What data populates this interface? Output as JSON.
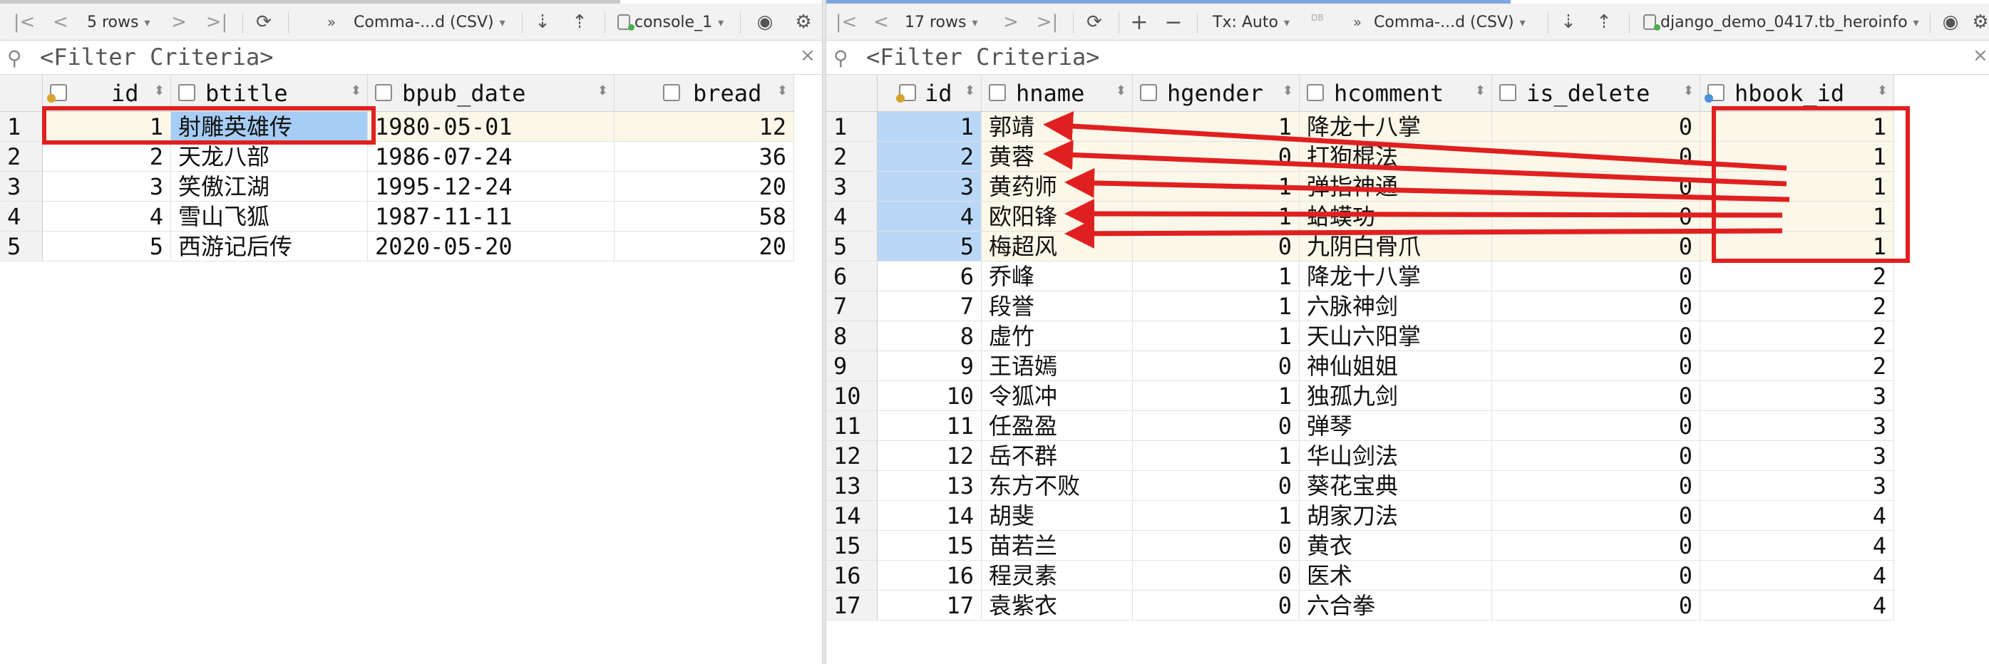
{
  "left": {
    "toolbar": {
      "first_icon": "|<",
      "prev_icon": "<",
      "rows": "5 rows",
      "next_icon": ">",
      "last_icon": ">|",
      "refresh_icon": "refresh-icon",
      "more_icon": "»",
      "format": "Comma-...d (CSV)",
      "download_icon": "⇣",
      "upload_icon": "⇡",
      "console": "console_1",
      "eye_icon": "eye-icon",
      "gear_icon": "gear-icon"
    },
    "filter": {
      "icon": "search-icon",
      "placeholder": "<Filter Criteria>",
      "clear": "×"
    },
    "columns": [
      "id",
      "btitle",
      "bpub_date",
      "bread"
    ],
    "rows": [
      {
        "n": "1",
        "id": "1",
        "btitle": "射雕英雄传",
        "bpub_date": "1980-05-01",
        "bread": "12"
      },
      {
        "n": "2",
        "id": "2",
        "btitle": "天龙八部",
        "bpub_date": "1986-07-24",
        "bread": "36"
      },
      {
        "n": "3",
        "id": "3",
        "btitle": "笑傲江湖",
        "bpub_date": "1995-12-24",
        "bread": "20"
      },
      {
        "n": "4",
        "id": "4",
        "btitle": "雪山飞狐",
        "bpub_date": "1987-11-11",
        "bread": "58"
      },
      {
        "n": "5",
        "id": "5",
        "btitle": "西游记后传",
        "bpub_date": "2020-05-20",
        "bread": "20"
      }
    ]
  },
  "right": {
    "toolbar": {
      "first_icon": "|<",
      "prev_icon": "<",
      "rows": "17 rows",
      "next_icon": ">",
      "last_icon": ">|",
      "refresh_icon": "refresh-icon",
      "add_icon": "+",
      "remove_icon": "−",
      "tx": "Tx: Auto",
      "db_label": "DB",
      "more_icon": "»",
      "format": "Comma-...d (CSV)",
      "download_icon": "⇣",
      "upload_icon": "⇡",
      "table": "django_demo_0417.tb_heroinfo",
      "eye_icon": "eye-icon",
      "gear_icon": "gear-icon"
    },
    "filter": {
      "icon": "search-icon",
      "placeholder": "<Filter Criteria>",
      "clear": "×"
    },
    "columns": [
      "id",
      "hname",
      "hgender",
      "hcomment",
      "is_delete",
      "hbook_id"
    ],
    "rows": [
      {
        "n": "1",
        "id": "1",
        "hname": "郭靖",
        "hgender": "1",
        "hcomment": "降龙十八掌",
        "is_delete": "0",
        "hbook_id": "1"
      },
      {
        "n": "2",
        "id": "2",
        "hname": "黄蓉",
        "hgender": "0",
        "hcomment": "打狗棍法",
        "is_delete": "0",
        "hbook_id": "1"
      },
      {
        "n": "3",
        "id": "3",
        "hname": "黄药师",
        "hgender": "1",
        "hcomment": "弹指神通",
        "is_delete": "0",
        "hbook_id": "1"
      },
      {
        "n": "4",
        "id": "4",
        "hname": "欧阳锋",
        "hgender": "1",
        "hcomment": "蛤蟆功",
        "is_delete": "0",
        "hbook_id": "1"
      },
      {
        "n": "5",
        "id": "5",
        "hname": "梅超风",
        "hgender": "0",
        "hcomment": "九阴白骨爪",
        "is_delete": "0",
        "hbook_id": "1"
      },
      {
        "n": "6",
        "id": "6",
        "hname": "乔峰",
        "hgender": "1",
        "hcomment": "降龙十八掌",
        "is_delete": "0",
        "hbook_id": "2"
      },
      {
        "n": "7",
        "id": "7",
        "hname": "段誉",
        "hgender": "1",
        "hcomment": "六脉神剑",
        "is_delete": "0",
        "hbook_id": "2"
      },
      {
        "n": "8",
        "id": "8",
        "hname": "虚竹",
        "hgender": "1",
        "hcomment": "天山六阳掌",
        "is_delete": "0",
        "hbook_id": "2"
      },
      {
        "n": "9",
        "id": "9",
        "hname": "王语嫣",
        "hgender": "0",
        "hcomment": "神仙姐姐",
        "is_delete": "0",
        "hbook_id": "2"
      },
      {
        "n": "10",
        "id": "10",
        "hname": "令狐冲",
        "hgender": "1",
        "hcomment": "独孤九剑",
        "is_delete": "0",
        "hbook_id": "3"
      },
      {
        "n": "11",
        "id": "11",
        "hname": "任盈盈",
        "hgender": "0",
        "hcomment": "弹琴",
        "is_delete": "0",
        "hbook_id": "3"
      },
      {
        "n": "12",
        "id": "12",
        "hname": "岳不群",
        "hgender": "1",
        "hcomment": "华山剑法",
        "is_delete": "0",
        "hbook_id": "3"
      },
      {
        "n": "13",
        "id": "13",
        "hname": "东方不败",
        "hgender": "0",
        "hcomment": "葵花宝典",
        "is_delete": "0",
        "hbook_id": "3"
      },
      {
        "n": "14",
        "id": "14",
        "hname": "胡斐",
        "hgender": "1",
        "hcomment": "胡家刀法",
        "is_delete": "0",
        "hbook_id": "4"
      },
      {
        "n": "15",
        "id": "15",
        "hname": "苗若兰",
        "hgender": "0",
        "hcomment": "黄衣",
        "is_delete": "0",
        "hbook_id": "4"
      },
      {
        "n": "16",
        "id": "16",
        "hname": "程灵素",
        "hgender": "0",
        "hcomment": "医术",
        "is_delete": "0",
        "hbook_id": "4"
      },
      {
        "n": "17",
        "id": "17",
        "hname": "袁紫衣",
        "hgender": "0",
        "hcomment": "六合拳",
        "is_delete": "0",
        "hbook_id": "4"
      }
    ]
  },
  "colors": {
    "annotation": "#e02020",
    "selection": "#a6cdf5",
    "row_highlight": "#fbf8e9",
    "header_bg": "#f2f2f2"
  }
}
